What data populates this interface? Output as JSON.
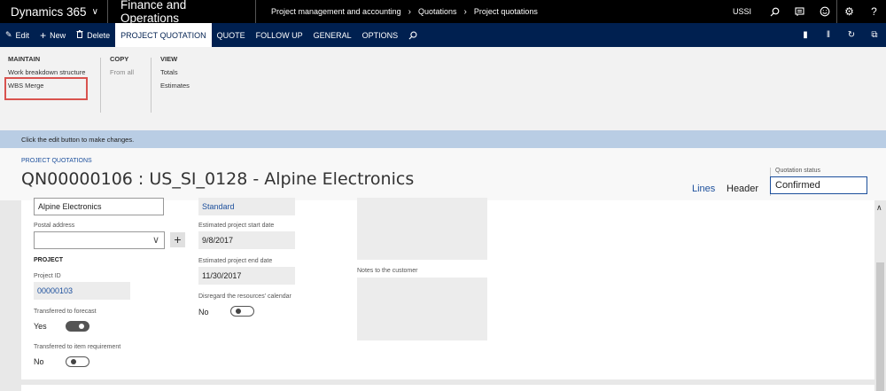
{
  "topbar": {
    "app_name": "Dynamics 365",
    "module": "Finance and Operations",
    "breadcrumb": [
      "Project management and accounting",
      "Quotations",
      "Project quotations"
    ],
    "company": "USSI"
  },
  "actionbar": {
    "edit": "Edit",
    "new": "New",
    "delete": "Delete",
    "tabs": [
      "PROJECT QUOTATION",
      "QUOTE",
      "FOLLOW UP",
      "GENERAL",
      "OPTIONS"
    ]
  },
  "ribbon": {
    "maintain": {
      "heading": "MAINTAIN",
      "items": [
        "Work breakdown structure",
        "WBS Merge"
      ]
    },
    "copy": {
      "heading": "COPY",
      "items": [
        "From all"
      ]
    },
    "view": {
      "heading": "VIEW",
      "items": [
        "Totals",
        "Estimates"
      ]
    }
  },
  "message": "Click the edit button to make changes.",
  "header": {
    "kicker": "PROJECT QUOTATIONS",
    "title": "QN00000106 : US_SI_0128 - Alpine Electronics",
    "lines_link": "Lines",
    "header_link": "Header",
    "status_label": "Quotation status",
    "status_value": "Confirmed"
  },
  "form": {
    "name_value": "Alpine Electronics",
    "postal_address_label": "Postal address",
    "postal_address_value": "",
    "project_section": "PROJECT",
    "project_id_label": "Project ID",
    "project_id_value": "00000103",
    "transferred_forecast_label": "Transferred to forecast",
    "transferred_forecast_value": "Yes",
    "transferred_item_label": "Transferred to item requirement",
    "transferred_item_value": "No",
    "type_value": "Standard",
    "est_start_label": "Estimated project start date",
    "est_start_value": "9/8/2017",
    "est_end_label": "Estimated project end date",
    "est_end_value": "11/30/2017",
    "disregard_label": "Disregard the resources' calendar",
    "disregard_value": "No",
    "notes_label": "Notes to the customer"
  },
  "colors": {
    "topbar": "#000000",
    "actionbar": "#002050",
    "message_bar": "#b9cde4",
    "link": "#1c4f9c",
    "highlight": "#d9534f"
  }
}
